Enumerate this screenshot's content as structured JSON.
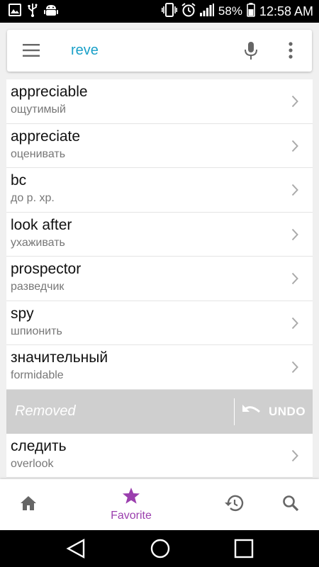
{
  "status_bar": {
    "battery": "58%",
    "time": "12:58 AM"
  },
  "search": {
    "query": "reve"
  },
  "list": {
    "items": [
      {
        "word": "appreciable",
        "translation": "ощутимый"
      },
      {
        "word": "appreciate",
        "translation": "оценивать"
      },
      {
        "word": "bc",
        "translation": "до р. хр."
      },
      {
        "word": "look after",
        "translation": "ухаживать"
      },
      {
        "word": "prospector",
        "translation": "разведчик"
      },
      {
        "word": "spy",
        "translation": "шпионить"
      },
      {
        "word": "значительный",
        "translation": "formidable"
      }
    ],
    "removed_label": "Removed",
    "undo_label": "UNDO",
    "after_removed": {
      "word": "следить",
      "translation": "overlook"
    }
  },
  "bottom_nav": {
    "active_label": "Favorite",
    "accent_color": "#9b3fae"
  },
  "icons": [
    "image-icon",
    "usb-icon",
    "android-debug-icon",
    "vibrate-icon",
    "alarm-icon",
    "signal-icon",
    "battery-icon",
    "menu-icon",
    "mic-icon",
    "more-vert-icon",
    "chevron-right-icon",
    "undo-icon",
    "home-icon",
    "star-icon",
    "history-icon",
    "search-icon",
    "back-icon",
    "home-circle-icon",
    "recents-icon"
  ]
}
